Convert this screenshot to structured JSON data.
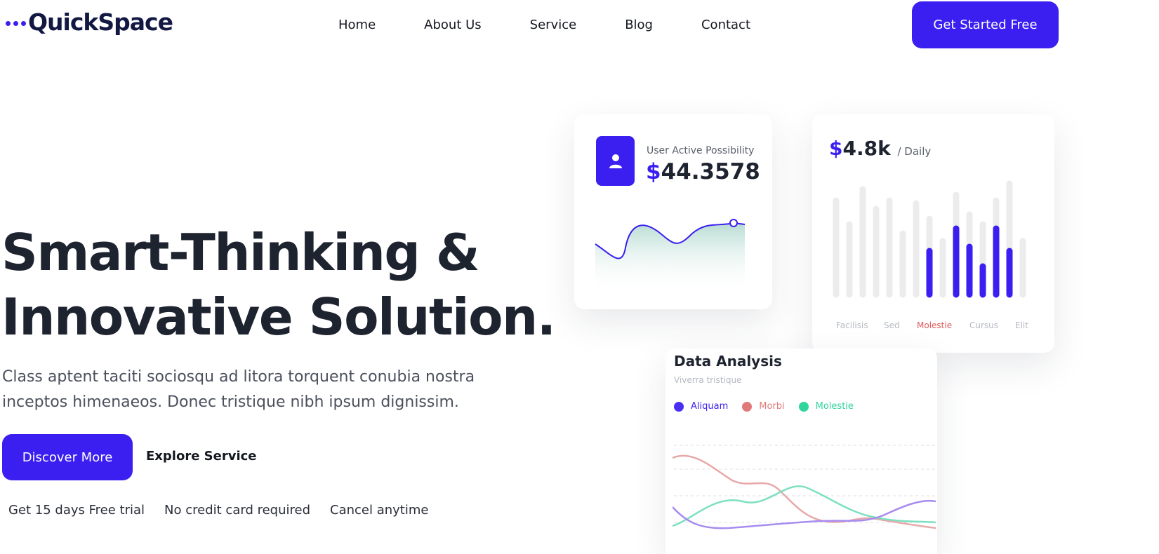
{
  "header": {
    "logo": "QuickSpace",
    "nav": [
      "Home",
      "About Us",
      "Service",
      "Blog",
      "Contact"
    ],
    "cta": "Get Started Free"
  },
  "hero": {
    "title_line1": "Smart-Thinking &",
    "title_line2": "Innovative Solution.",
    "description": "Class aptent taciti sociosqu ad litora torquent conubia nostra inceptos himenaeos. Donec tristique nibh ipsum dignissim.",
    "primary_button": "Discover More",
    "secondary_button": "Explore Service",
    "perks": [
      "Get 15 days Free trial",
      "No credit card required",
      "Cancel anytime"
    ]
  },
  "card_user": {
    "label": "User Active Possibility",
    "currency": "$",
    "value": "44.3578",
    "icon": "user-icon"
  },
  "card_daily": {
    "currency": "$",
    "value": "4.8k",
    "period": "/ Daily",
    "labels": [
      "Facilisis",
      "Sed",
      "Molestie",
      "Cursus",
      "Elit"
    ],
    "highlight_label": "Molestie"
  },
  "card_analysis": {
    "title": "Data Analysis",
    "subtitle": "Viverra tristique",
    "legend": [
      {
        "name": "Aliquam",
        "color": "#4a2ff2",
        "text_color": "#3a1ff0"
      },
      {
        "name": "Morbi",
        "color": "#e07a7a",
        "text_color": "#e07a7a"
      },
      {
        "name": "Molestie",
        "color": "#2fd59a",
        "text_color": "#2fd59a"
      }
    ]
  },
  "colors": {
    "accent": "#3a1ff0",
    "text_dark": "#1e2330",
    "bar_bg": "#ececec"
  }
}
